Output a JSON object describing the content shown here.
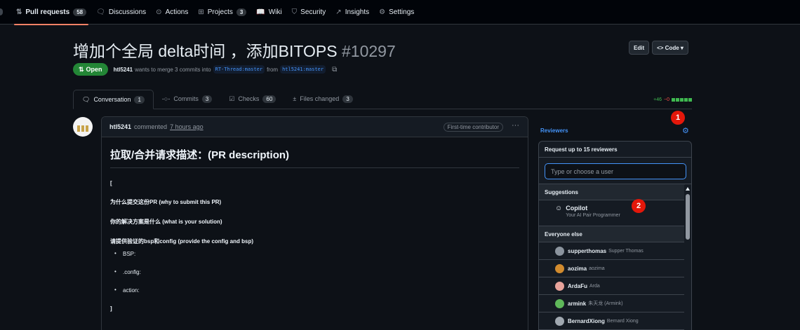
{
  "repo_nav": {
    "items": [
      {
        "icon": "git-pull-request-icon",
        "glyph": "⇅",
        "label": "Pull requests",
        "count": "58"
      },
      {
        "icon": "discussions-icon",
        "glyph": "🗨",
        "label": "Discussions"
      },
      {
        "icon": "actions-icon",
        "glyph": "⊙",
        "label": "Actions"
      },
      {
        "icon": "projects-icon",
        "glyph": "⊞",
        "label": "Projects",
        "count": "3"
      },
      {
        "icon": "wiki-icon",
        "glyph": "📖",
        "label": "Wiki"
      },
      {
        "icon": "security-icon",
        "glyph": "⛉",
        "label": "Security"
      },
      {
        "icon": "insights-icon",
        "glyph": "↗",
        "label": "Insights"
      },
      {
        "icon": "settings-gear-icon",
        "glyph": "⚙",
        "label": "Settings"
      }
    ]
  },
  "pr": {
    "title": "增加个全局 delta时间 ，添加BITOPS",
    "number": "#10297",
    "state": "Open",
    "author": "htl5241",
    "merge_text": "wants to merge 3 commits into",
    "base_branch": "RT-Thread:master",
    "from_text": "from",
    "head_branch": "htl5241:master"
  },
  "header_buttons": {
    "edit": "Edit",
    "code": "<> Code ▾"
  },
  "tabs": [
    {
      "icon": "conversation-icon",
      "glyph": "🗨",
      "label": "Conversation",
      "count": "1"
    },
    {
      "icon": "commits-icon",
      "glyph": "-○-",
      "label": "Commits",
      "count": "3"
    },
    {
      "icon": "checks-icon",
      "glyph": "☑",
      "label": "Checks",
      "count": "60"
    },
    {
      "icon": "files-changed-icon",
      "glyph": "±",
      "label": "Files changed",
      "count": "3"
    }
  ],
  "diffstat": {
    "additions": "+46",
    "deletions": "−0"
  },
  "comment": {
    "author": "htl5241",
    "action": "commented",
    "time": "7 hours ago",
    "badge": "First-time contributor",
    "menu": "···",
    "heading": "拉取/合并请求描述：(PR description)",
    "lines": [
      "[",
      "为什么提交这份PR (why to submit this PR)",
      "你的解决方案是什么 (what is your solution)",
      "请提供验证的bsp和config (provide the config and bsp)"
    ],
    "bullets": [
      "BSP:",
      ".config:",
      "action:"
    ],
    "closing": "]"
  },
  "sidebar": {
    "reviewers_label": "Reviewers",
    "popover_title": "Request up to 15 reviewers",
    "search_placeholder": "Type or choose a user",
    "suggestions_header": "Suggestions",
    "suggestion": {
      "name": "Copilot",
      "subtitle": "Your AI Pair Programmer"
    },
    "everyone_header": "Everyone else",
    "users": [
      {
        "login": "supperthomas",
        "name": "Supper Thomas",
        "color": "#8b949e"
      },
      {
        "login": "aozima",
        "name": "aozima",
        "color": "#d18b2e"
      },
      {
        "login": "ArdaFu",
        "name": "Arda",
        "color": "#e8a39b"
      },
      {
        "login": "armink",
        "name": "朱天龙 (Armink)",
        "color": "#5fb85a"
      },
      {
        "login": "BernardXiong",
        "name": "Bernard Xiong",
        "color": "#a0a8b0"
      }
    ]
  },
  "markers": [
    "1",
    "2"
  ]
}
